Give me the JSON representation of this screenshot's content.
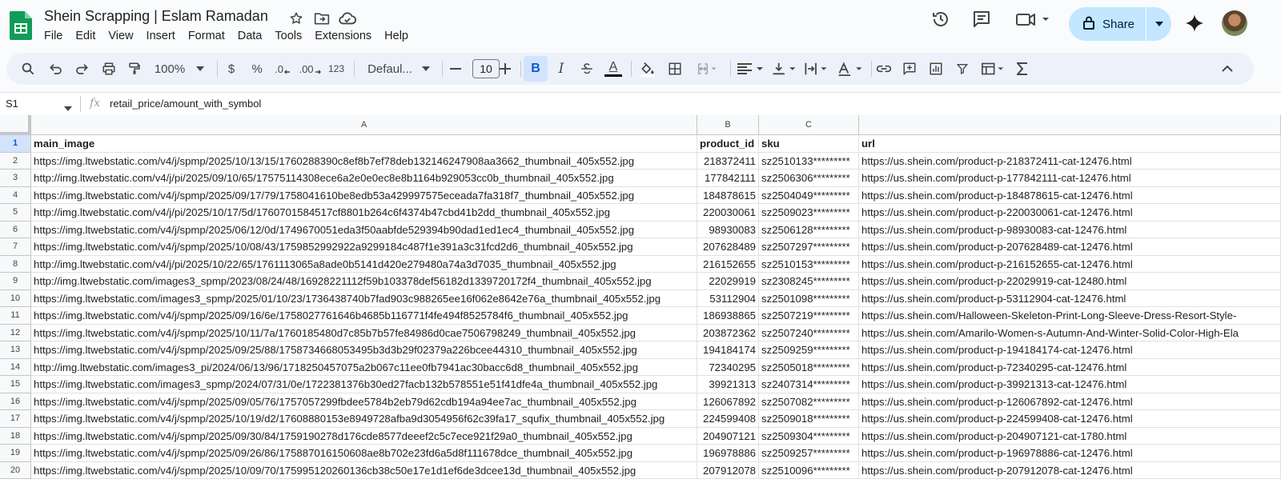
{
  "app": {
    "doc_title": "Shein Scrapping | Eslam Ramadan"
  },
  "menu": [
    "File",
    "Edit",
    "View",
    "Insert",
    "Format",
    "Data",
    "Tools",
    "Extensions",
    "Help"
  ],
  "share": {
    "label": "Share"
  },
  "toolbar": {
    "zoom": "100%",
    "currency": "$",
    "percent": "%",
    "dec_decrease": ".0",
    "dec_increase": ".00",
    "number_format": "123",
    "font": "Defaul...",
    "font_size": "10",
    "bold": "B",
    "italic": "I",
    "text_color": "A"
  },
  "formula_bar": {
    "cell_ref": "S1",
    "fx": "fx",
    "value": "retail_price/amount_with_symbol"
  },
  "columns": [
    "A",
    "B",
    "C",
    ""
  ],
  "headers": {
    "a": "main_image",
    "b": "product_id",
    "c": "sku",
    "d": "url"
  },
  "rows": [
    {
      "n": "2",
      "a": "https://img.ltwebstatic.com/v4/j/spmp/2025/10/13/15/1760288390c8ef8b7ef78deb132146247908aa3662_thumbnail_405x552.jpg",
      "b": "218372411",
      "c": "sz2510133*********",
      "d": "https://us.shein.com/product-p-218372411-cat-12476.html"
    },
    {
      "n": "3",
      "a": "http://img.ltwebstatic.com/v4/j/pi/2025/09/10/65/17575114308ece6a2e0e0ec8e8b1164b929053cc0b_thumbnail_405x552.jpg",
      "b": "177842111",
      "c": "sz2506306*********",
      "d": "https://us.shein.com/product-p-177842111-cat-12476.html"
    },
    {
      "n": "4",
      "a": "https://img.ltwebstatic.com/v4/j/spmp/2025/09/17/79/1758041610be8edb53a429997575eceada7fa318f7_thumbnail_405x552.jpg",
      "b": "184878615",
      "c": "sz2504049*********",
      "d": "https://us.shein.com/product-p-184878615-cat-12476.html"
    },
    {
      "n": "5",
      "a": "http://img.ltwebstatic.com/v4/j/pi/2025/10/17/5d/1760701584517cf8801b264c6f4374b47cbd41b2dd_thumbnail_405x552.jpg",
      "b": "220030061",
      "c": "sz2509023*********",
      "d": "https://us.shein.com/product-p-220030061-cat-12476.html"
    },
    {
      "n": "6",
      "a": "https://img.ltwebstatic.com/v4/j/spmp/2025/06/12/0d/1749670051eda3f50aabfde529394b90dad1ed1ec4_thumbnail_405x552.jpg",
      "b": "98930083",
      "c": "sz2506128*********",
      "d": "https://us.shein.com/product-p-98930083-cat-12476.html"
    },
    {
      "n": "7",
      "a": "https://img.ltwebstatic.com/v4/j/spmp/2025/10/08/43/1759852992922a9299184c487f1e391a3c31fcd2d6_thumbnail_405x552.jpg",
      "b": "207628489",
      "c": "sz2507297*********",
      "d": "https://us.shein.com/product-p-207628489-cat-12476.html"
    },
    {
      "n": "8",
      "a": "http://img.ltwebstatic.com/v4/j/pi/2025/10/22/65/1761113065a8ade0b5141d420e279480a74a3d7035_thumbnail_405x552.jpg",
      "b": "216152655",
      "c": "sz2510153*********",
      "d": "https://us.shein.com/product-p-216152655-cat-12476.html"
    },
    {
      "n": "9",
      "a": "http://img.ltwebstatic.com/images3_spmp/2023/08/24/48/16928221112f59b103378def56182d1339720172f4_thumbnail_405x552.jpg",
      "b": "22029919",
      "c": "sz2308245*********",
      "d": "https://us.shein.com/product-p-22029919-cat-12480.html"
    },
    {
      "n": "10",
      "a": "https://img.ltwebstatic.com/images3_spmp/2025/01/10/23/1736438740b7fad903c988265ee16f062e8642e76a_thumbnail_405x552.jpg",
      "b": "53112904",
      "c": "sz2501098*********",
      "d": "https://us.shein.com/product-p-53112904-cat-12476.html"
    },
    {
      "n": "11",
      "a": "https://img.ltwebstatic.com/v4/j/spmp/2025/09/16/6e/1758027761646b4685b116771f4fe494f8525784f6_thumbnail_405x552.jpg",
      "b": "186938865",
      "c": "sz2507219*********",
      "d": "https://us.shein.com/Halloween-Skeleton-Print-Long-Sleeve-Dress-Resort-Style-"
    },
    {
      "n": "12",
      "a": "https://img.ltwebstatic.com/v4/j/spmp/2025/10/11/7a/1760185480d7c85b7b57fe84986d0cae7506798249_thumbnail_405x552.jpg",
      "b": "203872362",
      "c": "sz2507240*********",
      "d": "https://us.shein.com/Amarilo-Women-s-Autumn-And-Winter-Solid-Color-High-Ela"
    },
    {
      "n": "13",
      "a": "https://img.ltwebstatic.com/v4/j/spmp/2025/09/25/88/1758734668053495b3d3b29f02379a226bcee44310_thumbnail_405x552.jpg",
      "b": "194184174",
      "c": "sz2509259*********",
      "d": "https://us.shein.com/product-p-194184174-cat-12476.html"
    },
    {
      "n": "14",
      "a": "http://img.ltwebstatic.com/images3_pi/2024/06/13/96/1718250457075a2b067c11ee0fb7941ac30bacc6d8_thumbnail_405x552.jpg",
      "b": "72340295",
      "c": "sz2505018*********",
      "d": "https://us.shein.com/product-p-72340295-cat-12476.html"
    },
    {
      "n": "15",
      "a": "https://img.ltwebstatic.com/images3_spmp/2024/07/31/0e/1722381376b30ed27facb132b578551e51f41dfe4a_thumbnail_405x552.jpg",
      "b": "39921313",
      "c": "sz2407314*********",
      "d": "https://us.shein.com/product-p-39921313-cat-12476.html"
    },
    {
      "n": "16",
      "a": "https://img.ltwebstatic.com/v4/j/spmp/2025/09/05/76/1757057299fbdee5784b2eb79d62cdb194a94ee7ac_thumbnail_405x552.jpg",
      "b": "126067892",
      "c": "sz2507082*********",
      "d": "https://us.shein.com/product-p-126067892-cat-12476.html"
    },
    {
      "n": "17",
      "a": "https://img.ltwebstatic.com/v4/j/spmp/2025/10/19/d2/17608880153e8949728afba9d3054956f62c39fa17_squfix_thumbnail_405x552.jpg",
      "b": "224599408",
      "c": "sz2509018*********",
      "d": "https://us.shein.com/product-p-224599408-cat-12476.html"
    },
    {
      "n": "18",
      "a": "https://img.ltwebstatic.com/v4/j/spmp/2025/09/30/84/1759190278d176cde8577deeef2c5c7ece921f29a0_thumbnail_405x552.jpg",
      "b": "204907121",
      "c": "sz2509304*********",
      "d": "https://us.shein.com/product-p-204907121-cat-1780.html"
    },
    {
      "n": "19",
      "a": "https://img.ltwebstatic.com/v4/j/spmp/2025/09/26/86/175887016150608ae8b702e23fd6a5d8f111678dce_thumbnail_405x552.jpg",
      "b": "196978886",
      "c": "sz2509257*********",
      "d": "https://us.shein.com/product-p-196978886-cat-12476.html"
    },
    {
      "n": "20",
      "a": "https://img.ltwebstatic.com/v4/j/spmp/2025/10/09/70/175995120260136cb38c50e17e1d1ef6de3dcee13d_thumbnail_405x552.jpg",
      "b": "207912078",
      "c": "sz2510096*********",
      "d": "https://us.shein.com/product-p-207912078-cat-12476.html"
    }
  ],
  "colors": {
    "accent": "#0b57d0",
    "share_bg": "#c2e7ff",
    "sheets_green": "#0f9d58"
  }
}
